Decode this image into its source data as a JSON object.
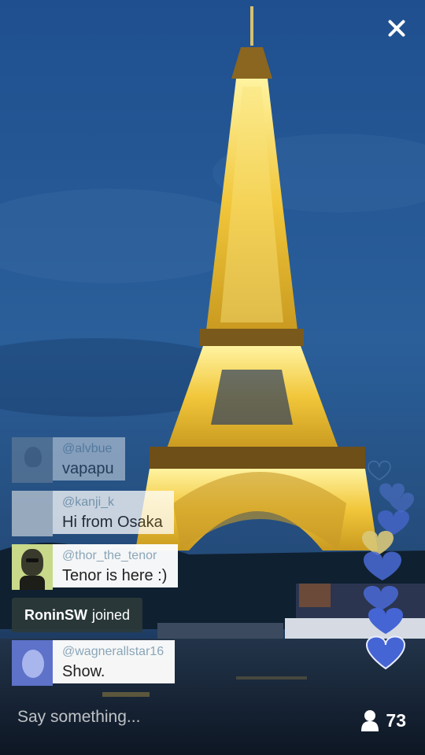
{
  "broadcast": {
    "close_icon": "close-icon"
  },
  "comments": [
    {
      "handle": "@alvbue",
      "text": "vapapu"
    },
    {
      "handle": "@kanji_k",
      "text": "Hi from Osaka"
    },
    {
      "handle": "@thor_the_tenor",
      "text": "Tenor is here :)"
    },
    {
      "handle": "@wagnerallstar16",
      "text": "Show."
    }
  ],
  "joined": {
    "name": "RoninSW",
    "suffix": "joined"
  },
  "composer": {
    "placeholder": "Say something..."
  },
  "viewers": {
    "icon": "person-icon",
    "count": "73"
  },
  "hearts": {
    "icon": "heart-icon",
    "colors": [
      "#5b7be0",
      "#4a6ad6",
      "#d8c878",
      "#6f86e4"
    ]
  }
}
